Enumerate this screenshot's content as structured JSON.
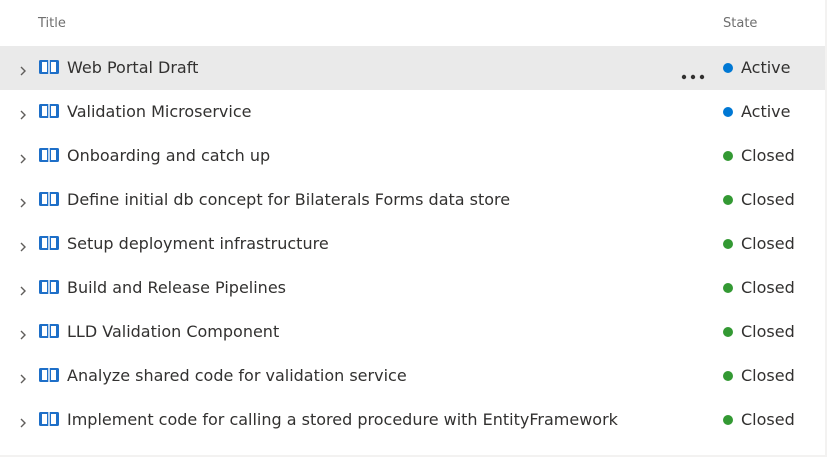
{
  "header": {
    "title_label": "Title",
    "state_label": "State"
  },
  "colors": {
    "active": "#0078d4",
    "closed": "#339933",
    "book_icon": "#1e6fc8",
    "selected_row_bg": "#eaeaea"
  },
  "icons": {
    "expand": "chevron-right-icon",
    "work_item": "book-icon",
    "more": "more-options-icon",
    "state": "status-dot-icon"
  },
  "rows": [
    {
      "title": "Web Portal Draft",
      "state": "Active",
      "selected": true
    },
    {
      "title": "Validation Microservice",
      "state": "Active",
      "selected": false
    },
    {
      "title": "Onboarding and catch up",
      "state": "Closed",
      "selected": false
    },
    {
      "title": "Define initial db concept for Bilaterals Forms data store",
      "state": "Closed",
      "selected": false
    },
    {
      "title": "Setup deployment infrastructure",
      "state": "Closed",
      "selected": false
    },
    {
      "title": "Build and Release Pipelines",
      "state": "Closed",
      "selected": false
    },
    {
      "title": "LLD Validation Component",
      "state": "Closed",
      "selected": false
    },
    {
      "title": "Analyze shared code for validation service",
      "state": "Closed",
      "selected": false
    },
    {
      "title": "Implement code for calling a stored procedure with EntityFramework",
      "state": "Closed",
      "selected": false
    }
  ]
}
